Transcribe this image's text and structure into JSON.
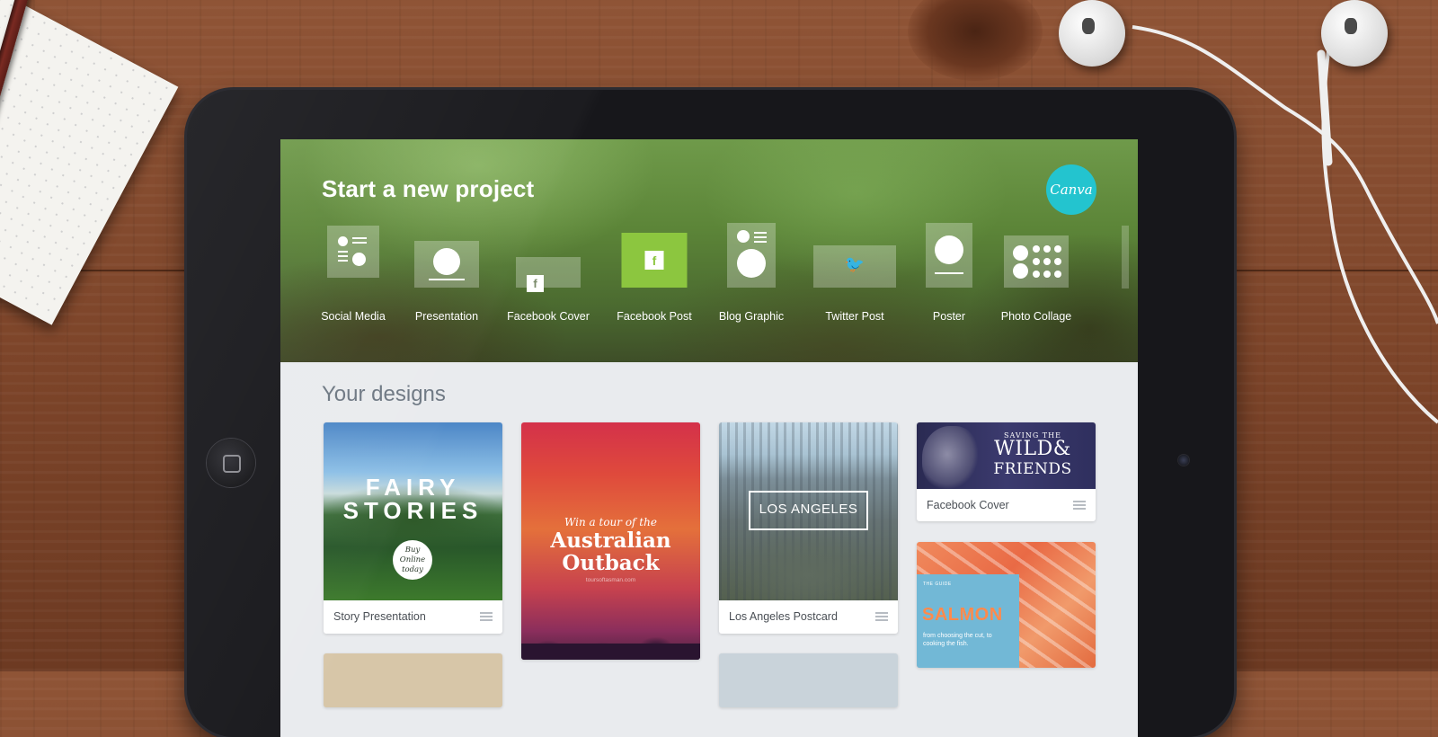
{
  "app": {
    "hero_title": "Start a new project",
    "logo_text": "Canva",
    "accent_color": "#8cc63f",
    "logo_color": "#23c4cf"
  },
  "project_types": [
    {
      "label": "Social Media",
      "icon": "social-media-icon"
    },
    {
      "label": "Presentation",
      "icon": "presentation-icon"
    },
    {
      "label": "Facebook Cover",
      "icon": "facebook-cover-icon",
      "glyph": "f"
    },
    {
      "label": "Facebook Post",
      "icon": "facebook-post-icon",
      "glyph": "f",
      "selected": true
    },
    {
      "label": "Blog Graphic",
      "icon": "blog-graphic-icon"
    },
    {
      "label": "Twitter Post",
      "icon": "twitter-post-icon",
      "glyph": "🐦"
    },
    {
      "label": "Poster",
      "icon": "poster-icon"
    },
    {
      "label": "Photo Collage",
      "icon": "photo-collage-icon"
    }
  ],
  "designs": {
    "title": "Your designs",
    "cards": [
      {
        "caption": "Story Presentation",
        "thumb_line1": "FAIRY",
        "thumb_line2": "STORIES",
        "badge": "Buy Online today"
      },
      {
        "thumb_sub": "Win a tour of the",
        "thumb_line1": "Australian",
        "thumb_line2": "Outback",
        "thumb_url": "toursoftasman.com"
      },
      {
        "caption": "Los Angeles Postcard",
        "thumb_text": "LOS ANGELES"
      },
      {
        "caption": "Facebook Cover",
        "thumb_line1": "SAVING THE",
        "thumb_line2": "WILD&",
        "thumb_line3": "FRIENDS"
      },
      {
        "thumb_guide": "THE GUIDE",
        "thumb_title": "SALMON",
        "thumb_sub": "from choosing the cut, to cooking the fish."
      }
    ]
  }
}
